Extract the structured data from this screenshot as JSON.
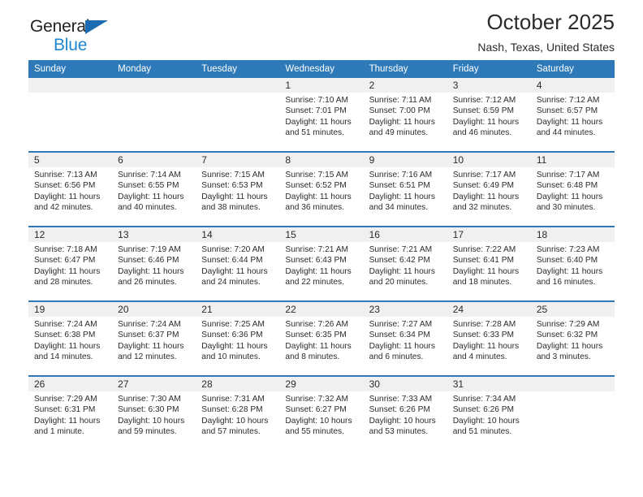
{
  "brand": {
    "name_part1": "General",
    "name_part2": "Blue",
    "logo_icon": "triangle-icon"
  },
  "header": {
    "title": "October 2025",
    "subtitle": "Nash, Texas, United States"
  },
  "colors": {
    "header_blue": "#2e7ab8",
    "brand_blue": "#1f86d0",
    "daynum_band": "#f0f0f0",
    "text": "#2b2b2b"
  },
  "weekday_headers": [
    "Sunday",
    "Monday",
    "Tuesday",
    "Wednesday",
    "Thursday",
    "Friday",
    "Saturday"
  ],
  "labels": {
    "sunrise_prefix": "Sunrise:",
    "sunset_prefix": "Sunset:",
    "daylight_prefix": "Daylight:"
  },
  "weeks": [
    [
      {
        "day": "",
        "empty": true
      },
      {
        "day": "",
        "empty": true
      },
      {
        "day": "",
        "empty": true
      },
      {
        "day": "1",
        "sunrise": "Sunrise: 7:10 AM",
        "sunset": "Sunset: 7:01 PM",
        "daylight_line1": "Daylight: 11 hours",
        "daylight_line2": "and 51 minutes."
      },
      {
        "day": "2",
        "sunrise": "Sunrise: 7:11 AM",
        "sunset": "Sunset: 7:00 PM",
        "daylight_line1": "Daylight: 11 hours",
        "daylight_line2": "and 49 minutes."
      },
      {
        "day": "3",
        "sunrise": "Sunrise: 7:12 AM",
        "sunset": "Sunset: 6:59 PM",
        "daylight_line1": "Daylight: 11 hours",
        "daylight_line2": "and 46 minutes."
      },
      {
        "day": "4",
        "sunrise": "Sunrise: 7:12 AM",
        "sunset": "Sunset: 6:57 PM",
        "daylight_line1": "Daylight: 11 hours",
        "daylight_line2": "and 44 minutes."
      }
    ],
    [
      {
        "day": "5",
        "sunrise": "Sunrise: 7:13 AM",
        "sunset": "Sunset: 6:56 PM",
        "daylight_line1": "Daylight: 11 hours",
        "daylight_line2": "and 42 minutes."
      },
      {
        "day": "6",
        "sunrise": "Sunrise: 7:14 AM",
        "sunset": "Sunset: 6:55 PM",
        "daylight_line1": "Daylight: 11 hours",
        "daylight_line2": "and 40 minutes."
      },
      {
        "day": "7",
        "sunrise": "Sunrise: 7:15 AM",
        "sunset": "Sunset: 6:53 PM",
        "daylight_line1": "Daylight: 11 hours",
        "daylight_line2": "and 38 minutes."
      },
      {
        "day": "8",
        "sunrise": "Sunrise: 7:15 AM",
        "sunset": "Sunset: 6:52 PM",
        "daylight_line1": "Daylight: 11 hours",
        "daylight_line2": "and 36 minutes."
      },
      {
        "day": "9",
        "sunrise": "Sunrise: 7:16 AM",
        "sunset": "Sunset: 6:51 PM",
        "daylight_line1": "Daylight: 11 hours",
        "daylight_line2": "and 34 minutes."
      },
      {
        "day": "10",
        "sunrise": "Sunrise: 7:17 AM",
        "sunset": "Sunset: 6:49 PM",
        "daylight_line1": "Daylight: 11 hours",
        "daylight_line2": "and 32 minutes."
      },
      {
        "day": "11",
        "sunrise": "Sunrise: 7:17 AM",
        "sunset": "Sunset: 6:48 PM",
        "daylight_line1": "Daylight: 11 hours",
        "daylight_line2": "and 30 minutes."
      }
    ],
    [
      {
        "day": "12",
        "sunrise": "Sunrise: 7:18 AM",
        "sunset": "Sunset: 6:47 PM",
        "daylight_line1": "Daylight: 11 hours",
        "daylight_line2": "and 28 minutes."
      },
      {
        "day": "13",
        "sunrise": "Sunrise: 7:19 AM",
        "sunset": "Sunset: 6:46 PM",
        "daylight_line1": "Daylight: 11 hours",
        "daylight_line2": "and 26 minutes."
      },
      {
        "day": "14",
        "sunrise": "Sunrise: 7:20 AM",
        "sunset": "Sunset: 6:44 PM",
        "daylight_line1": "Daylight: 11 hours",
        "daylight_line2": "and 24 minutes."
      },
      {
        "day": "15",
        "sunrise": "Sunrise: 7:21 AM",
        "sunset": "Sunset: 6:43 PM",
        "daylight_line1": "Daylight: 11 hours",
        "daylight_line2": "and 22 minutes."
      },
      {
        "day": "16",
        "sunrise": "Sunrise: 7:21 AM",
        "sunset": "Sunset: 6:42 PM",
        "daylight_line1": "Daylight: 11 hours",
        "daylight_line2": "and 20 minutes."
      },
      {
        "day": "17",
        "sunrise": "Sunrise: 7:22 AM",
        "sunset": "Sunset: 6:41 PM",
        "daylight_line1": "Daylight: 11 hours",
        "daylight_line2": "and 18 minutes."
      },
      {
        "day": "18",
        "sunrise": "Sunrise: 7:23 AM",
        "sunset": "Sunset: 6:40 PM",
        "daylight_line1": "Daylight: 11 hours",
        "daylight_line2": "and 16 minutes."
      }
    ],
    [
      {
        "day": "19",
        "sunrise": "Sunrise: 7:24 AM",
        "sunset": "Sunset: 6:38 PM",
        "daylight_line1": "Daylight: 11 hours",
        "daylight_line2": "and 14 minutes."
      },
      {
        "day": "20",
        "sunrise": "Sunrise: 7:24 AM",
        "sunset": "Sunset: 6:37 PM",
        "daylight_line1": "Daylight: 11 hours",
        "daylight_line2": "and 12 minutes."
      },
      {
        "day": "21",
        "sunrise": "Sunrise: 7:25 AM",
        "sunset": "Sunset: 6:36 PM",
        "daylight_line1": "Daylight: 11 hours",
        "daylight_line2": "and 10 minutes."
      },
      {
        "day": "22",
        "sunrise": "Sunrise: 7:26 AM",
        "sunset": "Sunset: 6:35 PM",
        "daylight_line1": "Daylight: 11 hours",
        "daylight_line2": "and 8 minutes."
      },
      {
        "day": "23",
        "sunrise": "Sunrise: 7:27 AM",
        "sunset": "Sunset: 6:34 PM",
        "daylight_line1": "Daylight: 11 hours",
        "daylight_line2": "and 6 minutes."
      },
      {
        "day": "24",
        "sunrise": "Sunrise: 7:28 AM",
        "sunset": "Sunset: 6:33 PM",
        "daylight_line1": "Daylight: 11 hours",
        "daylight_line2": "and 4 minutes."
      },
      {
        "day": "25",
        "sunrise": "Sunrise: 7:29 AM",
        "sunset": "Sunset: 6:32 PM",
        "daylight_line1": "Daylight: 11 hours",
        "daylight_line2": "and 3 minutes."
      }
    ],
    [
      {
        "day": "26",
        "sunrise": "Sunrise: 7:29 AM",
        "sunset": "Sunset: 6:31 PM",
        "daylight_line1": "Daylight: 11 hours",
        "daylight_line2": "and 1 minute."
      },
      {
        "day": "27",
        "sunrise": "Sunrise: 7:30 AM",
        "sunset": "Sunset: 6:30 PM",
        "daylight_line1": "Daylight: 10 hours",
        "daylight_line2": "and 59 minutes."
      },
      {
        "day": "28",
        "sunrise": "Sunrise: 7:31 AM",
        "sunset": "Sunset: 6:28 PM",
        "daylight_line1": "Daylight: 10 hours",
        "daylight_line2": "and 57 minutes."
      },
      {
        "day": "29",
        "sunrise": "Sunrise: 7:32 AM",
        "sunset": "Sunset: 6:27 PM",
        "daylight_line1": "Daylight: 10 hours",
        "daylight_line2": "and 55 minutes."
      },
      {
        "day": "30",
        "sunrise": "Sunrise: 7:33 AM",
        "sunset": "Sunset: 6:26 PM",
        "daylight_line1": "Daylight: 10 hours",
        "daylight_line2": "and 53 minutes."
      },
      {
        "day": "31",
        "sunrise": "Sunrise: 7:34 AM",
        "sunset": "Sunset: 6:26 PM",
        "daylight_line1": "Daylight: 10 hours",
        "daylight_line2": "and 51 minutes."
      },
      {
        "day": "",
        "empty": true
      }
    ]
  ]
}
